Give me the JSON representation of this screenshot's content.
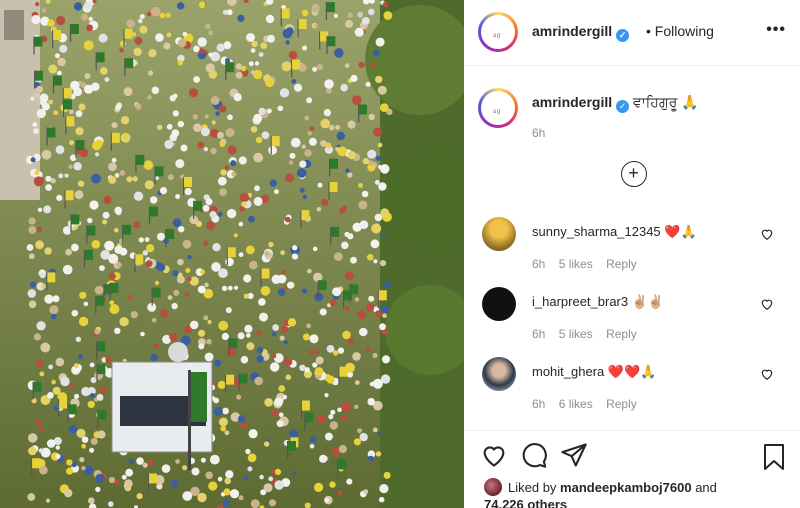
{
  "post": {
    "header": {
      "username": "amrindergill",
      "follow_status": "• Following",
      "more_icon": "more-horizontal-icon",
      "verified_icon": "verified-badge-icon"
    },
    "caption": {
      "username": "amrindergill",
      "text": "ਵਾਹਿਗੁਰੂ 🙏",
      "time": "6h"
    },
    "load_more_icon": "plus-circle-icon",
    "comments": [
      {
        "username": "sunny_sharma_12345",
        "text": "❤️🙏",
        "time": "6h",
        "likes": "5 likes",
        "reply": "Reply"
      },
      {
        "username": "i_harpreet_brar3",
        "text": "✌🏼✌🏼",
        "time": "6h",
        "likes": "5 likes",
        "reply": "Reply"
      },
      {
        "username": "mohit_ghera",
        "text": "❤️❤️🙏",
        "time": "6h",
        "likes": "6 likes",
        "reply": "Reply"
      }
    ],
    "footer": {
      "icons": [
        "heart-icon",
        "comment-icon",
        "share-icon",
        "bookmark-icon"
      ],
      "liked_by_prefix": "Liked by",
      "liked_by_user": "mandeepkamboj7600",
      "liked_by_suffix": "and",
      "others": "74,226 others"
    }
  },
  "colors": {
    "verified": "#3897f0",
    "heart_red": "#ed4956",
    "muted_text": "#8e8e8e",
    "flag_green": "#2f7a2a",
    "flag_yellow": "#e8d23a"
  }
}
